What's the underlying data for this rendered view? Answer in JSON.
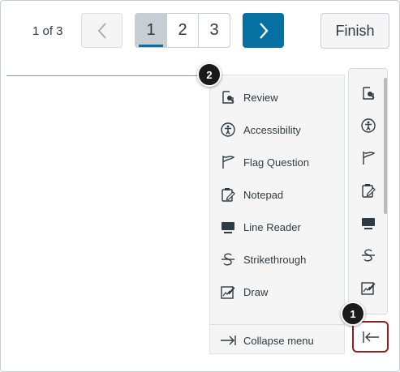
{
  "header": {
    "page_count": "1 of 3",
    "pages": [
      "1",
      "2",
      "3"
    ],
    "finish_label": "Finish"
  },
  "menu": {
    "items": [
      {
        "label": "Review",
        "icon": "review-icon"
      },
      {
        "label": "Accessibility",
        "icon": "accessibility-icon"
      },
      {
        "label": "Flag Question",
        "icon": "flag-icon"
      },
      {
        "label": "Notepad",
        "icon": "notepad-icon"
      },
      {
        "label": "Line Reader",
        "icon": "line-reader-icon"
      },
      {
        "label": "Strikethrough",
        "icon": "strikethrough-icon"
      },
      {
        "label": "Draw",
        "icon": "draw-icon"
      }
    ],
    "collapse_label": "Collapse menu"
  },
  "callouts": {
    "one": "1",
    "two": "2"
  },
  "colors": {
    "primary": "#0770a3",
    "highlight": "#9b1c22",
    "badge": "#1a1a1a"
  }
}
